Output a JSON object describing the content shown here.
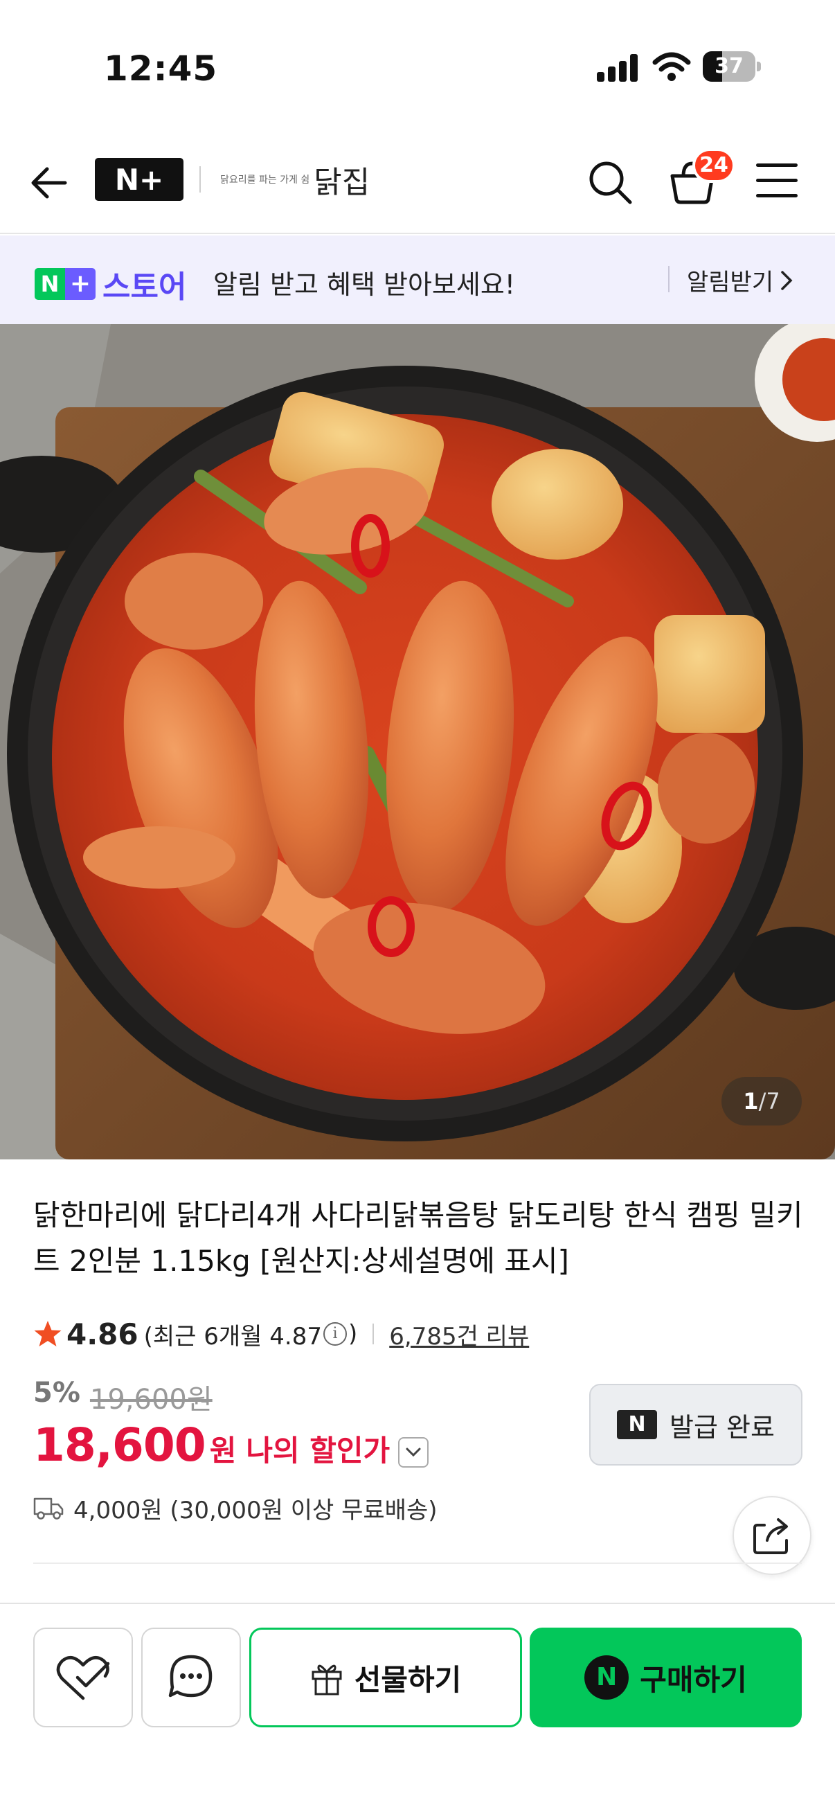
{
  "status_bar": {
    "time": "12:45",
    "battery_level": "37",
    "battery_fraction": 0.37
  },
  "header": {
    "brand_badge": "N+",
    "store_tagline": "닭요리를 파는 가게 쉼",
    "store_name": "닭집",
    "cart_count": "24",
    "icons": [
      "back-arrow-icon",
      "search-icon",
      "cart-icon",
      "menu-icon"
    ]
  },
  "notice": {
    "brand_n": "N",
    "brand_plus": "+",
    "brand_store": "스토어",
    "message": "알림 받고 혜택 받아보세요!",
    "action": "알림받기"
  },
  "gallery": {
    "current": "1",
    "separator": "/",
    "total": "7"
  },
  "product": {
    "title": "닭한마리에 닭다리4개 사다리닭볶음탕 닭도리탕 한식 캠핑 밀키트 2인분 1.15kg [원산지:상세설명에 표시]",
    "rating": "4.86",
    "recent_prefix": "(최근 6개월 4.87",
    "recent_suffix": ")",
    "review_count": "6,785건 리뷰",
    "discount_rate": "5%",
    "original_price": "19,600원",
    "sale_price": "18,600",
    "currency": "원",
    "price_label": "나의 할인가",
    "coupon_badge": "N",
    "coupon_label": "발급 완료",
    "shipping": "4,000원 (30,000원 이상 무료배송)"
  },
  "bottom_bar": {
    "gift_label": "선물하기",
    "buy_label": "구매하기",
    "buy_logo": "N"
  },
  "colors": {
    "naver_green": "#03c75a",
    "store_purple": "#5a48f5",
    "price_red": "#e3143f",
    "badge_red": "#ff3b1f",
    "notice_bg": "#f1f0fd"
  }
}
